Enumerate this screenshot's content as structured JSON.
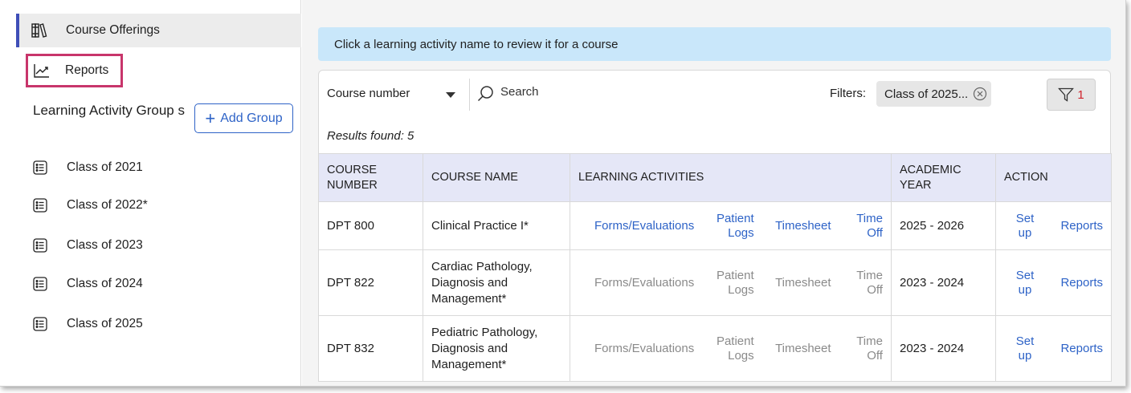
{
  "sidebar": {
    "course_offerings": "Course Offerings",
    "reports": "Reports",
    "group_title": "Learning Activity Group s",
    "add_group_label": "Add Group",
    "groups": [
      {
        "label": "Class of 2021"
      },
      {
        "label": "Class of 2022*"
      },
      {
        "label": "Class of 2023"
      },
      {
        "label": "Class of 2024"
      },
      {
        "label": "Class of 2025"
      }
    ]
  },
  "main": {
    "banner": "Click a learning activity name to review it for a course",
    "search": {
      "select_value": "Course number",
      "placeholder": "Search"
    },
    "filters_label": "Filters:",
    "filter_chip": "Class of 2025...",
    "filter_count": "1",
    "results_text": "Results found: 5",
    "columns": [
      "COURSE NUMBER",
      "COURSE NAME",
      "LEARNING ACTIVITIES",
      "ACADEMIC YEAR",
      "ACTION"
    ],
    "rows": [
      {
        "number": "DPT 800",
        "name": "Clinical Practice I*",
        "activities": [
          "Forms/Evaluations",
          "Patient Logs",
          "Timesheet",
          "Time Off"
        ],
        "year": "2025 - 2026",
        "setup": "Set up",
        "reports": "Reports",
        "active": true
      },
      {
        "number": "DPT 822",
        "name": "Cardiac Pathology, Diagnosis and Management*",
        "activities": [
          "Forms/Evaluations",
          "Patient Logs",
          "Timesheet",
          "Time Off"
        ],
        "year": "2023 - 2024",
        "setup": "Set up",
        "reports": "Reports",
        "active": false
      },
      {
        "number": "DPT 832",
        "name": "Pediatric Pathology, Diagnosis and Management*",
        "activities": [
          "Forms/Evaluations",
          "Patient Logs",
          "Timesheet",
          "Time Off"
        ],
        "year": "2023 - 2024",
        "setup": "Set up",
        "reports": "Reports",
        "active": false
      }
    ]
  },
  "colors": {
    "accent": "#2e63c7",
    "banner_bg": "#c9e7fa",
    "header_bg": "#e5e7f7",
    "highlight_border": "#c8356b",
    "active_bar": "#3f4fb8",
    "filter_count": "#d0232c"
  },
  "icons": {
    "course_offerings": "books-icon",
    "reports": "trending-chart-icon",
    "group": "list-icon",
    "search": "search-icon",
    "chip_remove": "close-circle-icon",
    "filter": "filter-funnel-icon"
  }
}
